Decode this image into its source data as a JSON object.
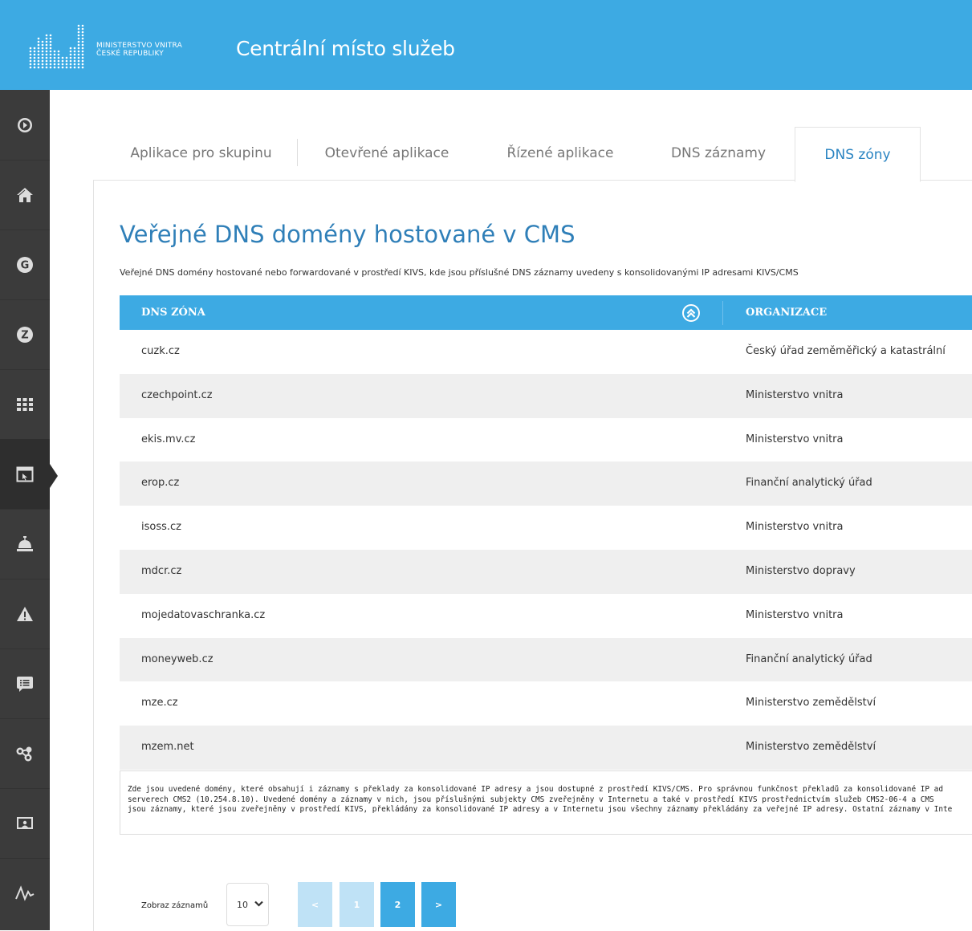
{
  "colors": {
    "brand": "#3daae3",
    "sidebar": "#3b3b3b",
    "heading": "#2f7fb8"
  },
  "header": {
    "ministry_line1": "MINISTERSTVO VNITRA",
    "ministry_line2": "ČESKÉ REPUBLIKY",
    "app_title": "Centrální místo služeb"
  },
  "sidebar": {
    "items": [
      {
        "icon": "arrow-circle-icon"
      },
      {
        "icon": "home-icon"
      },
      {
        "icon": "g-circle-icon"
      },
      {
        "icon": "z-circle-icon"
      },
      {
        "icon": "grid-icon"
      },
      {
        "icon": "app-window-icon",
        "active": true
      },
      {
        "icon": "service-bell-icon"
      },
      {
        "icon": "warning-icon"
      },
      {
        "icon": "message-icon"
      },
      {
        "icon": "network-icon"
      },
      {
        "icon": "presentation-icon"
      },
      {
        "icon": "activity-icon"
      }
    ]
  },
  "tabs": [
    {
      "label": "Aplikace pro skupinu"
    },
    {
      "label": "Otevřené aplikace"
    },
    {
      "label": "Řízené aplikace"
    },
    {
      "label": "DNS záznamy"
    },
    {
      "label": "DNS zóny",
      "active": true
    }
  ],
  "main": {
    "title": "Veřejné DNS domény hostované v CMS",
    "description": "Veřejné DNS domény hostované nebo forwardované v prostředí KIVS, kde jsou příslušné DNS záznamy uvedeny s konsolidovanými IP adresami KIVS/CMS"
  },
  "table": {
    "columns": [
      "DNS ZÓNA",
      "ORGANIZACE"
    ],
    "rows": [
      {
        "zone": "cuzk.cz",
        "org": "Český úřad zeměměřický a katastrální"
      },
      {
        "zone": "czechpoint.cz",
        "org": "Ministerstvo vnitra"
      },
      {
        "zone": "ekis.mv.cz",
        "org": "Ministerstvo vnitra"
      },
      {
        "zone": "erop.cz",
        "org": "Finanční analytický úřad"
      },
      {
        "zone": "isoss.cz",
        "org": "Ministerstvo vnitra"
      },
      {
        "zone": "mdcr.cz",
        "org": "Ministerstvo dopravy"
      },
      {
        "zone": "mojedatovaschranka.cz",
        "org": "Ministerstvo vnitra"
      },
      {
        "zone": "moneyweb.cz",
        "org": "Finanční analytický úřad"
      },
      {
        "zone": "mze.cz",
        "org": "Ministerstvo zemědělství"
      },
      {
        "zone": "mzem.net",
        "org": "Ministerstvo zemědělství"
      }
    ]
  },
  "note": {
    "line1": "Zde jsou uvedené domény, které obsahují i záznamy s překlady za konsolidované IP adresy a jsou dostupné z prostředí KIVS/CMS. Pro správnou funkčnost překladů za konsolidované IP ad",
    "line2": "serverech CMS2 (10.254.8.10). Uvedené domény a záznamy v nich, jsou příslušnými subjekty CMS zveřejněny v Internetu a také v prostředí KIVS prostřednictvím služeb CMS2-06-4 a CMS",
    "line3": "jsou záznamy, které jsou zveřejněny v prostředí KIVS, překládány za konsolidované IP adresy a v Internetu jsou všechny záznamy překládány za veřejné IP adresy. Ostatní záznamy v Inte"
  },
  "pagination": {
    "label": "Zobraz záznamů",
    "page_size": "10",
    "prev": "<",
    "pages": [
      "1",
      "2"
    ],
    "current": "2",
    "next": ">"
  }
}
